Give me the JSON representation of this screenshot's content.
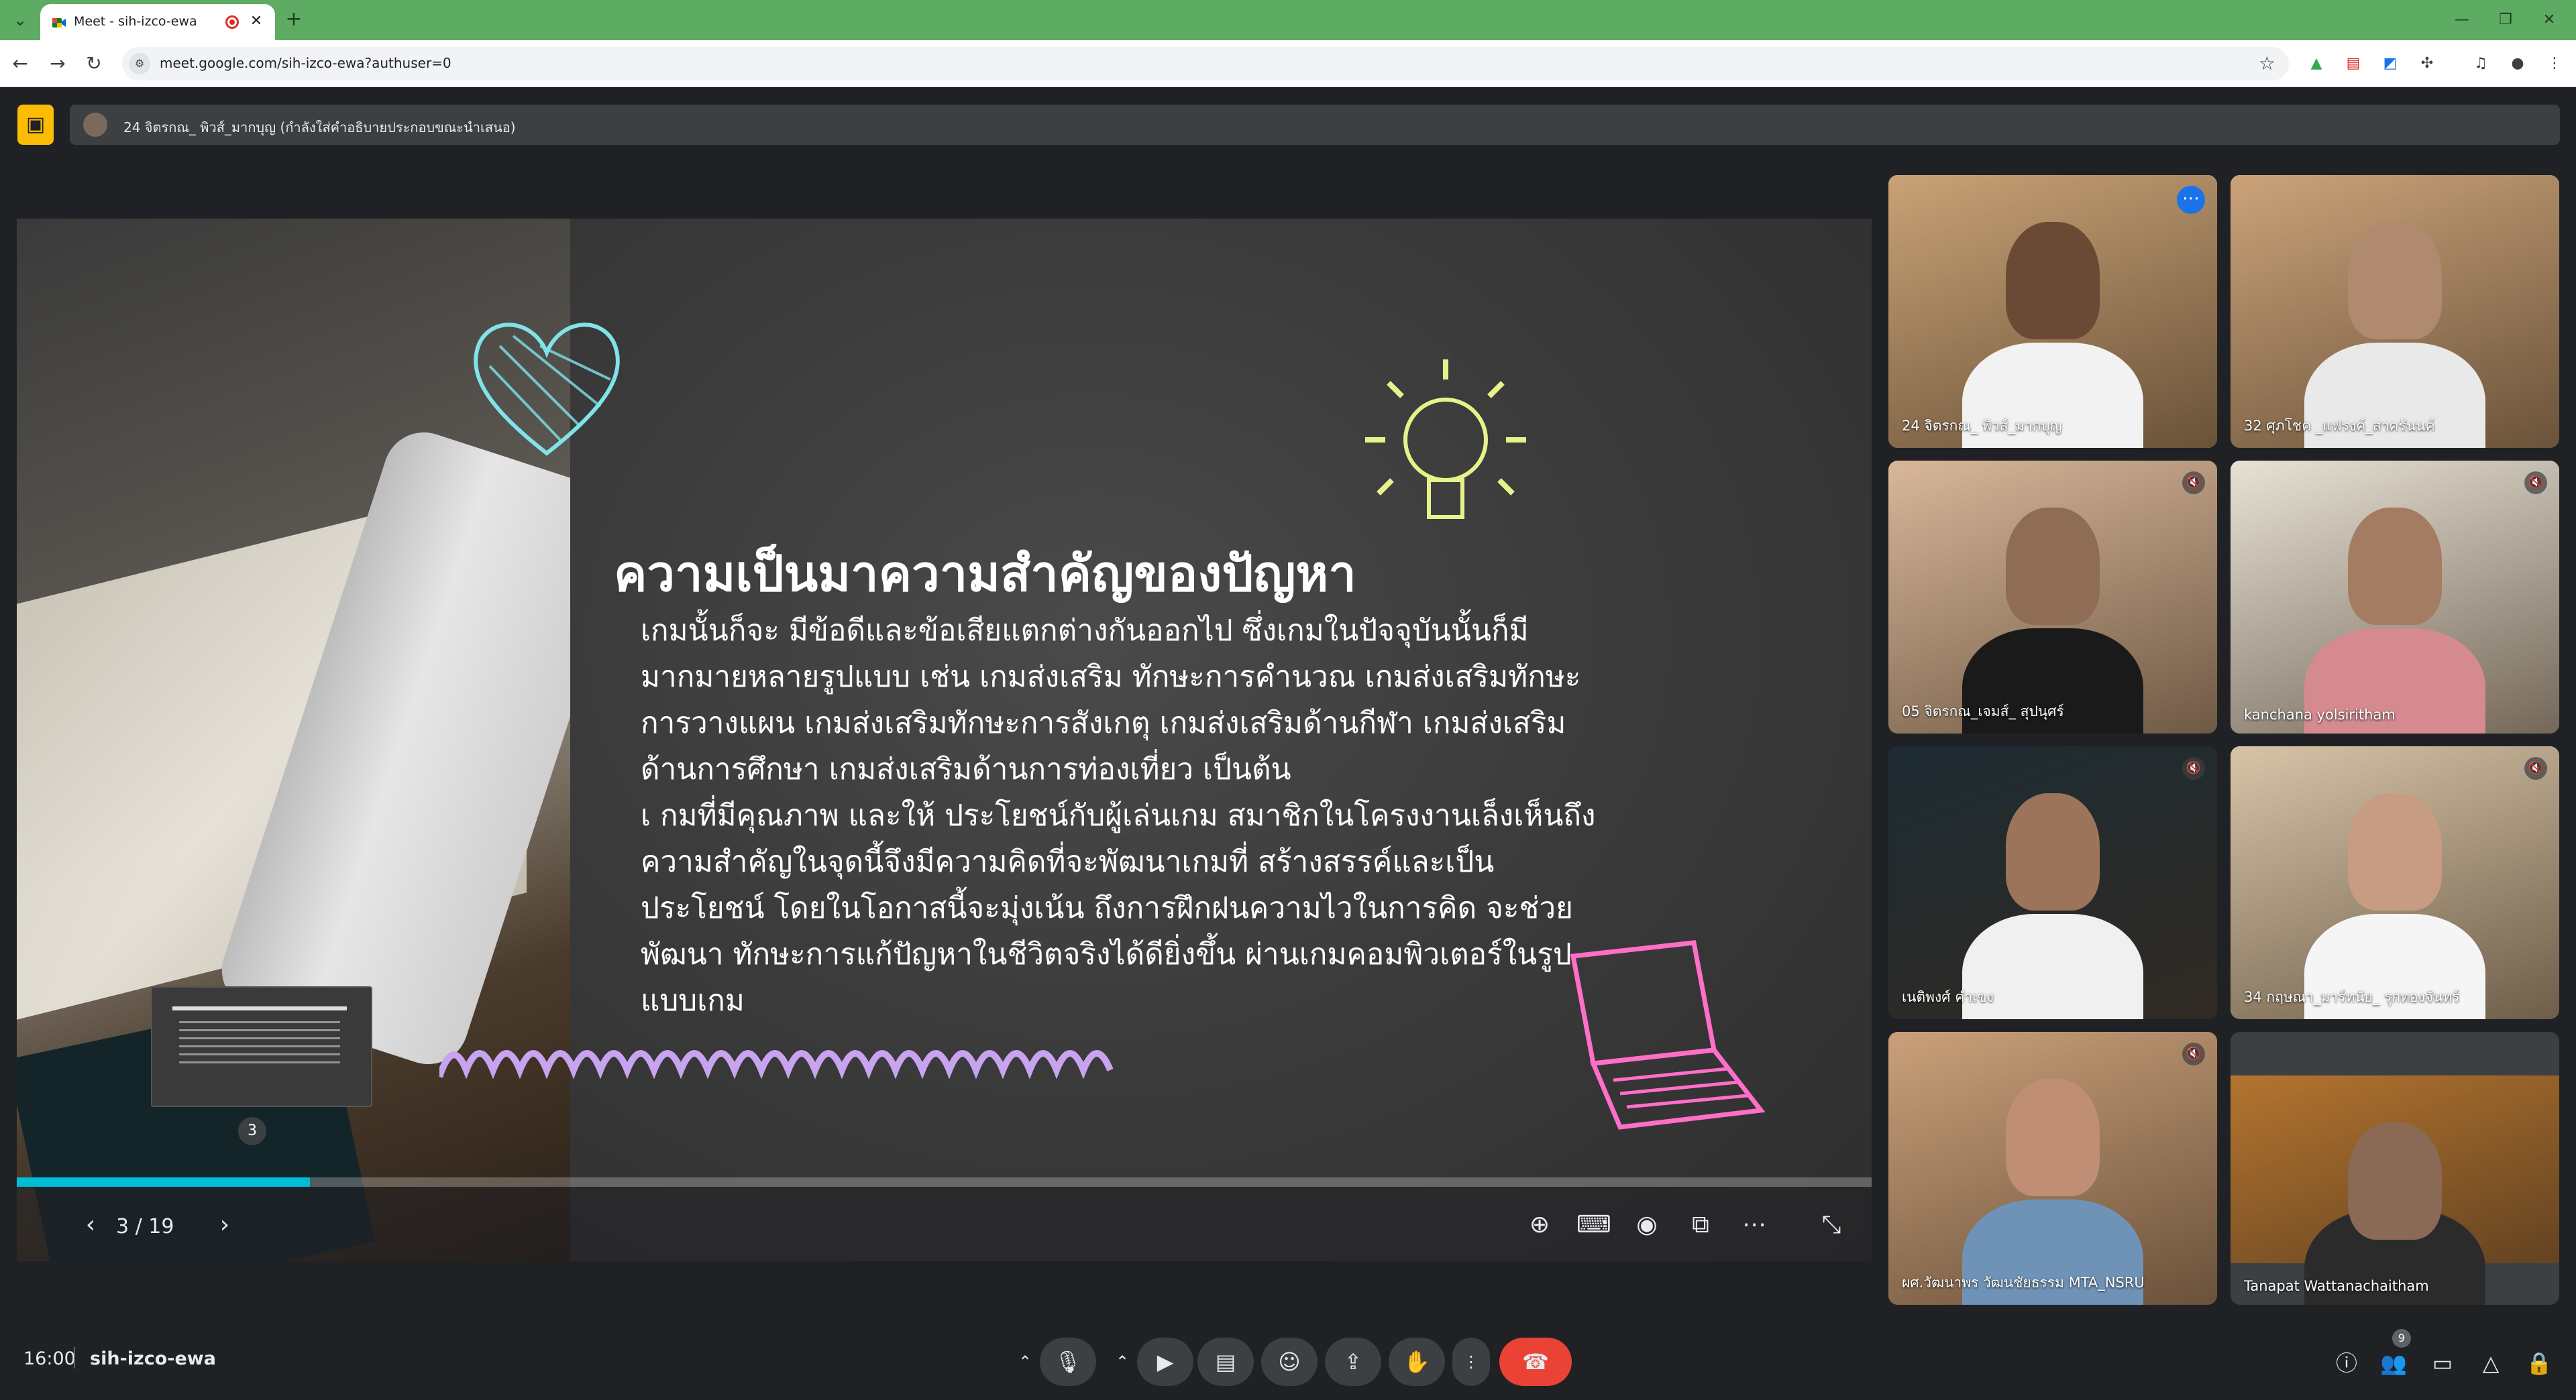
{
  "browser": {
    "tab_title": "Meet - sih-izco-ewa",
    "tab_close": "✕",
    "new_tab": "+",
    "url": "meet.google.com/sih-izco-ewa?authuser=0"
  },
  "presenter_bar": {
    "text": "24 จิตรกณ_ พิวส์_มากบุญ (กำลังใส่คำอธิบายประกอบขณะนำเสนอ)"
  },
  "slide": {
    "title": "ความเป็นมาความสำคัญของปัญหา",
    "body_lines": [
      "   เกมนั้นก็จะ มีข้อดีและข้อเสียแตกต่างกันออกไป ซึ่งเกมในปัจจุบันนั้นก็มี",
      "มากมายหลายรูปแบบ เช่น เกมส่งเสริม ทักษะการคำนวณ เกมส่งเสริมทักษะ",
      "การวางแผน เกมส่งเสริมทักษะการสังเกตุ เกมส่งเสริมด้านกีฬา เกมส่งเสริม",
      "ด้านการศึกษา เกมส่งเสริมด้านการท่องเที่ยว เป็นต้น",
      "เ กมที่มีคุณภาพ และให้ ประโยชน์กับผู้เล่นเกม สมาชิกในโครงงานเล็งเห็นถึง",
      "ความสำคัญในจุดนี้จึงมีความคิดที่จะพัฒนาเกมที่ สร้างสรรค์และเป็น",
      "ประโยชน์ โดยในโอกาสนี้จะมุ่งเน้น ถึงการฝึกฝนความไวในการคิด จะช่วย",
      "พัฒนา ทักษะการแก้ปัญหาในชีวิตจริงได้ดียิ่งขึ้น ผ่านเกมคอมพิวเตอร์ในรูป",
      "แบบเกม"
    ],
    "hover_thumb_number": "3",
    "page_indicator": "3 / 19",
    "progress_fraction": 0.158
  },
  "participants": [
    {
      "name": "24 จิตรกณ_ พิวส์_มากบุญ",
      "skin": "#6b4a35",
      "shirt": "#f2f2f2",
      "bg": "#c9a276"
    },
    {
      "name": "32 ศุภโชค _แฟรงค์_สาครันนค์",
      "skin": "#b08a6e",
      "shirt": "#e9e9e9",
      "bg": "#cba37a"
    },
    {
      "name": "05 จิตรกณ_เจมส์_ สุปนุศร์",
      "skin": "#8e6c55",
      "shirt": "#1a1a1a",
      "bg": "#d9b79a"
    },
    {
      "name": "kanchana yolsiritham",
      "skin": "#a47c62",
      "shirt": "#d48a8f",
      "bg": "#e8e2d6"
    },
    {
      "name": "เนติพงศ์ คำเขง",
      "skin": "#9c7459",
      "shirt": "#f0f0f0",
      "bg": "#1d2b33"
    },
    {
      "name": "34 กฤษณา_มาร์ทนัย_ รุกทองจันทร์",
      "skin": "#c79c82",
      "shirt": "#f5f5f5",
      "bg": "#d7c4a8"
    },
    {
      "name": "ผศ.วัฒนาพร วัฒนชัยธรรม MTA_NSRU",
      "skin": "#c08e74",
      "shirt": "#6f93b6",
      "bg": "#caa07a"
    },
    {
      "name": "Tanapat Wattanachaitham",
      "skin": "#8a6a55",
      "shirt": "#2b2b2b",
      "bg": "#b4742f"
    }
  ],
  "bottom": {
    "time": "16:00",
    "meeting_code": "sih-izco-ewa",
    "people_count": "9"
  },
  "colors": {
    "accent_tab": "#5eab63",
    "hangup": "#ea4335",
    "present_badge": "#fbbc04",
    "progress": "#00bcd4"
  }
}
